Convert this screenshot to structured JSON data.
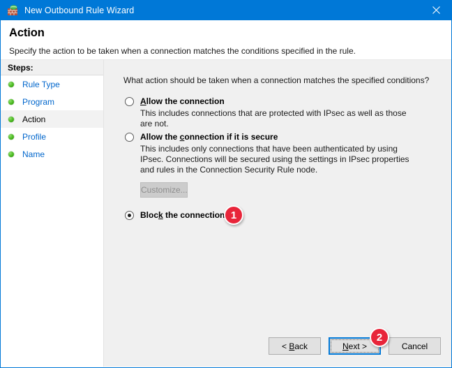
{
  "window": {
    "title": "New Outbound Rule Wizard",
    "icon": "firewall-icon",
    "accent_color": "#0078d7",
    "close_label": "✕"
  },
  "header": {
    "title": "Action",
    "subtitle": "Specify the action to be taken when a connection matches the conditions specified in the rule."
  },
  "sidebar": {
    "header": "Steps:",
    "items": [
      {
        "label": "Rule Type",
        "active": false
      },
      {
        "label": "Program",
        "active": false
      },
      {
        "label": "Action",
        "active": true
      },
      {
        "label": "Profile",
        "active": false
      },
      {
        "label": "Name",
        "active": false
      }
    ]
  },
  "main": {
    "question": "What action should be taken when a connection matches the specified conditions?",
    "options": [
      {
        "title_before": "",
        "title_accel": "A",
        "title_after": "llow the connection",
        "description": "This includes connections that are protected with IPsec as well as those are not.",
        "selected": false
      },
      {
        "title_before": "Allow the ",
        "title_accel": "c",
        "title_after": "onnection if it is secure",
        "description": "This includes only connections that have been authenticated by using IPsec.  Connections will be secured using the settings in IPsec properties and rules in the Connection Security Rule node.",
        "selected": false
      },
      {
        "title_before": "Bloc",
        "title_accel": "k",
        "title_after": " the connection",
        "description": "",
        "selected": true
      }
    ],
    "customize_button": {
      "label": "Customize...",
      "enabled": false
    }
  },
  "footer": {
    "buttons": [
      {
        "before": "< ",
        "accel": "B",
        "after": "ack",
        "default": false
      },
      {
        "before": "",
        "accel": "N",
        "after": "ext >",
        "default": true
      },
      {
        "before": "Cancel",
        "accel": "",
        "after": "",
        "default": false
      }
    ]
  },
  "annotations": {
    "badge_1": "1",
    "badge_2": "2",
    "badge_color": "#e8253a"
  }
}
